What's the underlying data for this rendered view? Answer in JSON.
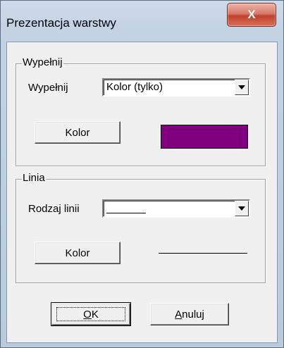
{
  "window": {
    "title": "Prezentacja warstwy",
    "close_glyph": "X"
  },
  "fill_group": {
    "title": "Wypełnij",
    "fill_label": "Wypełnij",
    "fill_select": {
      "value": "Kolor (tylko)"
    },
    "color_button_label": "Kolor",
    "color_swatch": "#800080"
  },
  "line_group": {
    "title": "Linia",
    "line_type_label": "Rodzaj linii",
    "line_select": {
      "value": "solid line",
      "icon": "solid-line-sample"
    },
    "color_button_label": "Kolor",
    "line_color": "#000000"
  },
  "buttons": {
    "ok": {
      "mnemonic": "O",
      "rest": "K"
    },
    "cancel": {
      "mnemonic": "A",
      "rest": "nuluj"
    }
  }
}
